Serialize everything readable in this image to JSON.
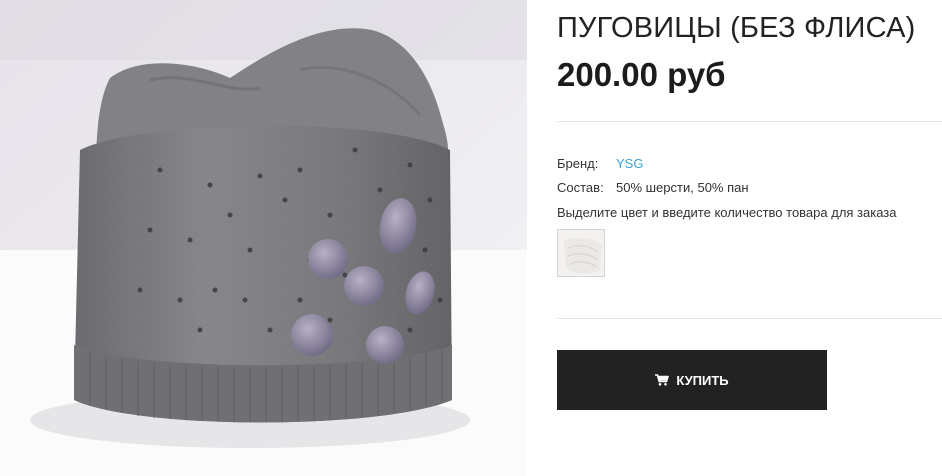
{
  "product": {
    "title": "ПУГОВИЦЫ (БЕЗ ФЛИСА)",
    "price": "200.00 руб",
    "image_alt": "Серая вязаная шапка с пуговицами"
  },
  "attributes": {
    "brand_label": "Бренд:",
    "brand_value": "YSG",
    "composition_label": "Состав:",
    "composition_value": "50% шерсти, 50% пан"
  },
  "instructions": "Выделите цвет и введите количество товара для заказа",
  "swatches": [
    {
      "name": "white",
      "color": "#f2f1ef"
    }
  ],
  "buy_button": {
    "label": "КУПИТЬ",
    "icon": "cart-icon"
  },
  "colors": {
    "button_bg": "#222222",
    "link": "#3aa3d8"
  }
}
